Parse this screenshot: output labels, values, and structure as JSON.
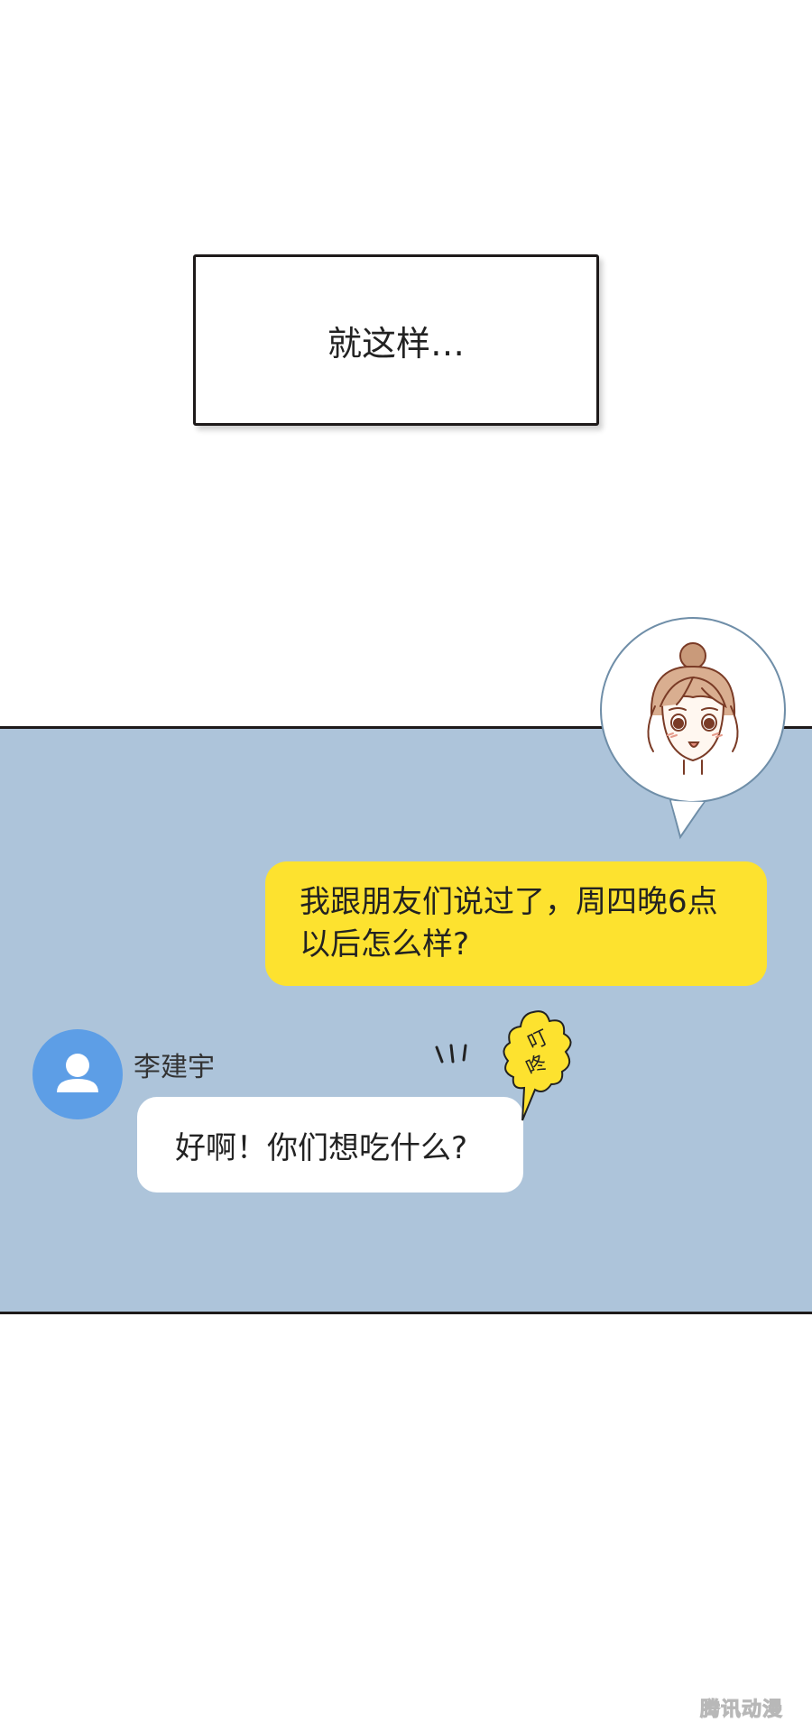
{
  "caption": {
    "text": "就这样…"
  },
  "messages": {
    "outgoing": {
      "line1": "我跟朋友们说过了，周四晚6点",
      "line2": "以后怎么样?"
    },
    "incoming": {
      "sender": "李建宇",
      "text": "好啊！你们想吃什么?"
    }
  },
  "sound_effect": {
    "text": "叮咚",
    "char1": "叮",
    "char2": "咚"
  },
  "watermark": {
    "text": "腾讯动漫"
  },
  "colors": {
    "chat_background": "#adc4da",
    "outgoing_bubble": "#fde22f",
    "incoming_bubble": "#ffffff",
    "avatar_blue": "#5d9ee6",
    "panel_border": "#1e1a1a"
  },
  "icons": {
    "sender_avatar": "person-icon",
    "character_portrait": "girl-portrait-illustration"
  }
}
